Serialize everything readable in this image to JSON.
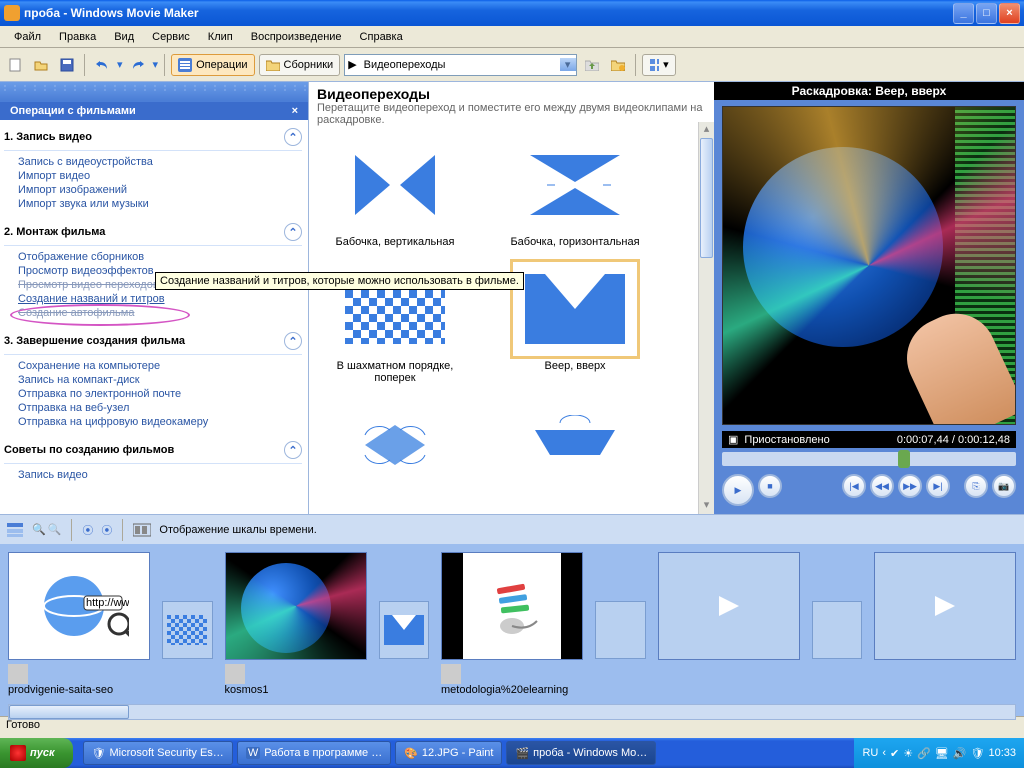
{
  "window": {
    "title": "проба - Windows Movie Maker"
  },
  "menu": [
    "Файл",
    "Правка",
    "Вид",
    "Сервис",
    "Клип",
    "Воспроизведение",
    "Справка"
  ],
  "toolbar": {
    "ops": "Операции",
    "coll": "Сборники",
    "combo": "Видеопереходы"
  },
  "side": {
    "header": "Операции с фильмами",
    "s1": "1. Запись видео",
    "s1items": [
      "Запись с видеоустройства",
      "Импорт видео",
      "Импорт изображений",
      "Импорт звука или музыки"
    ],
    "s2": "2. Монтаж фильма",
    "s2items": [
      "Отображение сборников",
      "Просмотр видеоэффектов",
      "Просмотр видео переходов",
      "Создание названий и титров",
      "Создание автофильма"
    ],
    "s3": "3. Завершение создания фильма",
    "s3items": [
      "Сохранение на компьютере",
      "Запись на компакт-диск",
      "Отправка по электронной почте",
      "Отправка на веб-узел",
      "Отправка на цифровую видеокамеру"
    ],
    "s4": "Советы по созданию фильмов",
    "s4items": [
      "Запись видео"
    ]
  },
  "tooltip": "Создание названий и титров, которые можно использовать в фильме.",
  "content": {
    "title": "Видеопереходы",
    "hint": "Перетащите видеопереход и поместите его между двумя видеоклипами на раскадровке.",
    "items": [
      "Бабочка, вертикальная",
      "Бабочка, горизонтальная",
      "В шахматном порядке, поперек",
      "Веер, вверх"
    ]
  },
  "preview": {
    "title": "Раскадровка: Веер, вверх",
    "status": "Приостановлено",
    "time": "0:00:07,44 / 0:00:12,48"
  },
  "timeline": {
    "label": "Отображение шкалы времени."
  },
  "clips": [
    "prodvigenie-saita-seo",
    "kosmos1",
    "metodologia%20elearning"
  ],
  "statusbar": "Готово",
  "task": {
    "start": "пуск",
    "btns": [
      "Microsoft Security Es…",
      "Работа в программе …",
      "12.JPG - Paint",
      "проба - Windows Mo…"
    ],
    "lang": "RU",
    "clock": "10:33"
  }
}
